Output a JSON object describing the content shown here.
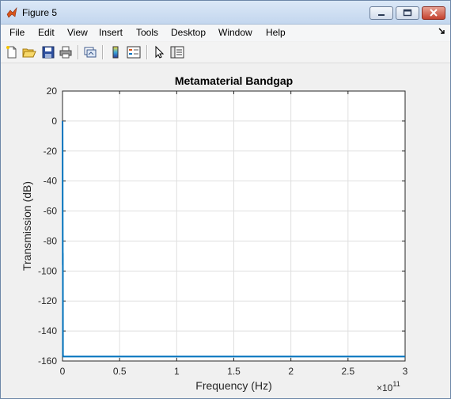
{
  "window": {
    "title": "Figure 5",
    "controls": [
      "minimize",
      "maximize",
      "close"
    ]
  },
  "menu": {
    "items": [
      "File",
      "Edit",
      "View",
      "Insert",
      "Tools",
      "Desktop",
      "Window",
      "Help"
    ],
    "overflow_icon": "arrow-icon"
  },
  "toolbar": {
    "tools": [
      "new-figure-icon",
      "open-file-icon",
      "save-icon",
      "print-icon",
      "link-plot-icon",
      "colorbar-icon",
      "legend-icon",
      "pointer-icon",
      "property-inspector-icon"
    ]
  },
  "chart_data": {
    "type": "line",
    "title": "Metamaterial Bandgap",
    "xlabel": "Frequency (Hz)",
    "ylabel": "Transmission (dB)",
    "xlim": [
      0,
      3
    ],
    "ylim": [
      -160,
      20
    ],
    "x_exponent_label": "×10",
    "x_exponent_power": "11",
    "xticks": [
      "0",
      "0.5",
      "1",
      "1.5",
      "2",
      "2.5",
      "3"
    ],
    "yticks": [
      "20",
      "0",
      "-20",
      "-40",
      "-60",
      "-80",
      "-100",
      "-120",
      "-140",
      "-160"
    ],
    "grid": true,
    "line_color": "#0072bd",
    "series": [
      {
        "x": [
          0,
          0.0005,
          0.001,
          0.0015,
          0.002,
          0.0025,
          0.003,
          0.0035,
          0.004,
          0.006,
          0.01,
          0.05,
          0.5,
          1,
          1.5,
          2,
          2.5,
          3
        ],
        "y": [
          0,
          -2,
          -20,
          -60,
          -74,
          -96,
          -88,
          -120,
          -156,
          -157,
          -157,
          -157,
          -157,
          -157,
          -157,
          -157,
          -157,
          -157
        ]
      }
    ]
  }
}
